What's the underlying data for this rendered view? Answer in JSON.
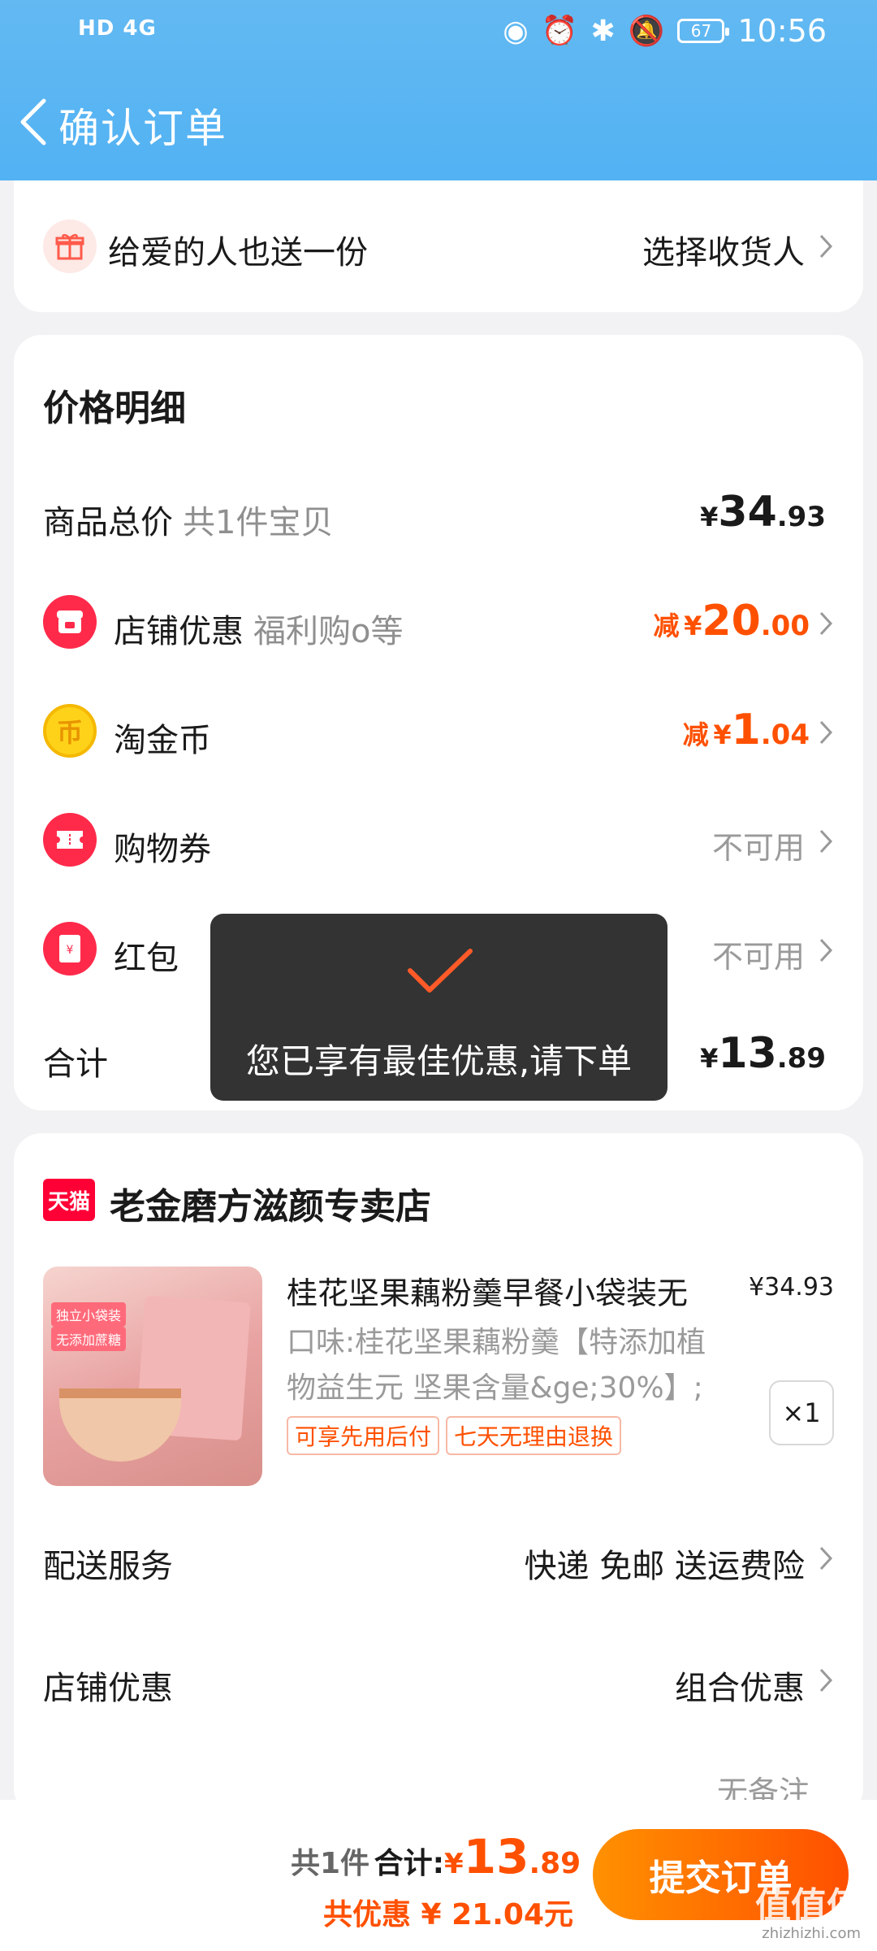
{
  "status_bar": {
    "left": "HD 4G",
    "battery": "67",
    "time": "10:56"
  },
  "header": {
    "title": "确认订单"
  },
  "gift": {
    "label": "给爱的人也送一份",
    "action": "选择收货人"
  },
  "price_detail": {
    "title": "价格明细",
    "goods_total": {
      "label": "商品总价",
      "sub": "共1件宝贝",
      "currency": "¥",
      "int": "34",
      "dec": ".93"
    },
    "shop_discount": {
      "label": "店铺优惠",
      "sub": "福利购o等",
      "prefix": "减",
      "currency": "¥",
      "int": "20",
      "dec": ".00"
    },
    "coins": {
      "label": "淘金币",
      "prefix": "减",
      "currency": "¥",
      "int": "1",
      "dec": ".04"
    },
    "voucher": {
      "label": "购物券",
      "value": "不可用"
    },
    "redpacket": {
      "label": "红包",
      "value": "不可用"
    },
    "total": {
      "label": "合计",
      "currency": "¥",
      "int": "13",
      "dec": ".89"
    }
  },
  "toast": {
    "message": "您已享有最佳优惠,请下单"
  },
  "shop": {
    "badge": "天猫",
    "name": "老金磨方滋颜专卖店",
    "product": {
      "title": "桂花坚果藕粉羹早餐小袋装无",
      "price": "¥34.93",
      "spec_line1": "口味:桂花坚果藕粉羹【特添加植",
      "spec_line2": "物益生元 坚果含量&ge;30%】;",
      "tags": [
        "可享先用后付",
        "七天无理由退换"
      ],
      "qty": "×1",
      "img_labels": [
        "独立小袋装",
        "无添加蔗糖"
      ]
    },
    "delivery": {
      "label": "配送服务",
      "value": "快递 免邮 送运费险"
    },
    "shop_discount": {
      "label": "店铺优惠",
      "value": "组合优惠"
    },
    "remark": {
      "value": "无备注"
    }
  },
  "bottom": {
    "count": "共1件",
    "total_label": "合计:",
    "currency": "¥",
    "int": "13",
    "dec": ".89",
    "saved": "共优惠 ¥ 21.04元",
    "submit": "提交订单"
  },
  "watermark": {
    "main": "值值值",
    "sub": "zhizhizhi.com"
  },
  "colors": {
    "accent": "#ff5000",
    "header": "#55b4f3",
    "toast": "#333333"
  }
}
